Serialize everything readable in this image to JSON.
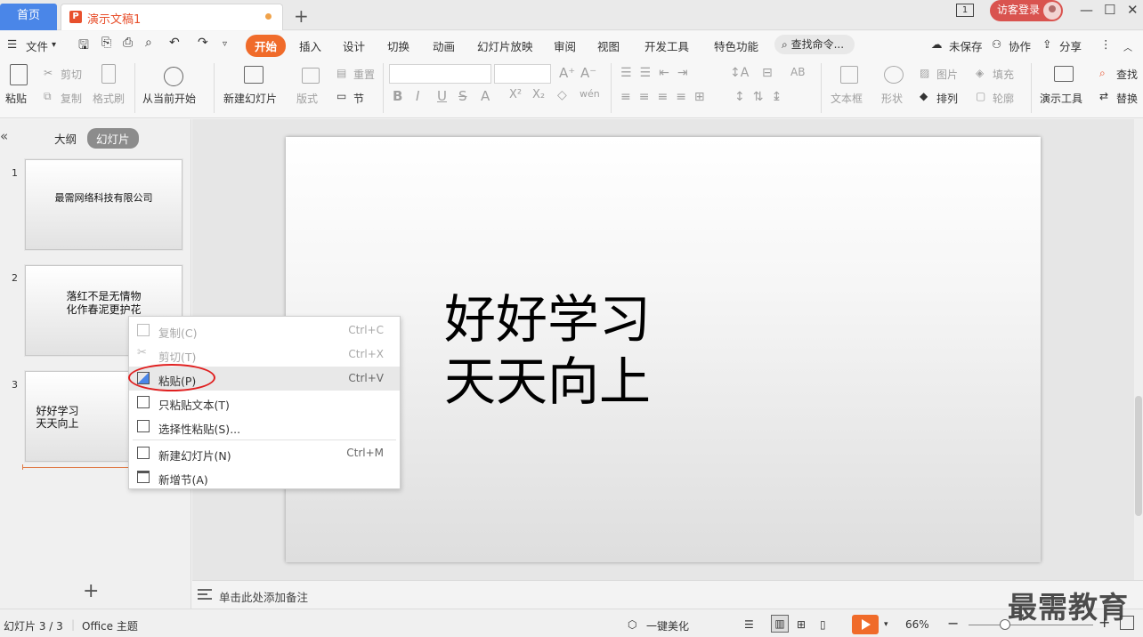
{
  "titlebar": {
    "home_tab": "首页",
    "doc_icon": "P",
    "doc_title": "演示文稿1",
    "add_tab": "+",
    "window_badge": "1",
    "login": "访客登录",
    "minimize": "—",
    "maximize": "☐",
    "close": "✕"
  },
  "menubar": {
    "file": "文件",
    "tabs": [
      "开始",
      "插入",
      "设计",
      "切换",
      "动画",
      "幻灯片放映",
      "审阅",
      "视图",
      "开发工具",
      "特色功能"
    ],
    "search": "查找命令...",
    "unsaved": "未保存",
    "collab": "协作",
    "share": "分享"
  },
  "toolbar": {
    "paste": "粘贴",
    "cut": "剪切",
    "copy": "复制",
    "format_painter": "格式刷",
    "from_current": "从当前开始",
    "new_slide": "新建幻灯片",
    "layout": "版式",
    "reset": "重置",
    "section": "节",
    "text_box": "文本框",
    "shape": "形状",
    "picture": "图片",
    "fill": "填充",
    "arrange": "排列",
    "outline": "轮廓",
    "present_tools": "演示工具",
    "find": "查找",
    "replace": "替换"
  },
  "left_panel": {
    "outline_tab": "大纲",
    "slides_tab": "幻灯片",
    "slides": [
      {
        "num": "1",
        "lines": [
          "最需网络科技有限公司"
        ]
      },
      {
        "num": "2",
        "lines": [
          "落红不是无情物",
          "化作春泥更护花"
        ]
      },
      {
        "num": "3",
        "lines": [
          "好好学习",
          "天天向上"
        ]
      }
    ]
  },
  "slide": {
    "line1": "好好学习",
    "line2": "天天向上"
  },
  "notes": {
    "placeholder": "单击此处添加备注"
  },
  "context_menu": {
    "items": [
      {
        "label": "复制(C)",
        "shortcut": "Ctrl+C"
      },
      {
        "label": "剪切(T)",
        "shortcut": "Ctrl+X"
      },
      {
        "label": "粘贴(P)",
        "shortcut": "Ctrl+V"
      },
      {
        "label": "只粘贴文本(T)",
        "shortcut": ""
      },
      {
        "label": "选择性粘贴(S)...",
        "shortcut": ""
      },
      {
        "label": "新建幻灯片(N)",
        "shortcut": "Ctrl+M"
      },
      {
        "label": "新增节(A)",
        "shortcut": ""
      }
    ]
  },
  "statusbar": {
    "slide_count": "幻灯片 3 / 3",
    "theme": "Office 主题",
    "beautify": "一键美化",
    "zoom": "66%",
    "watermark": "最需教育"
  }
}
